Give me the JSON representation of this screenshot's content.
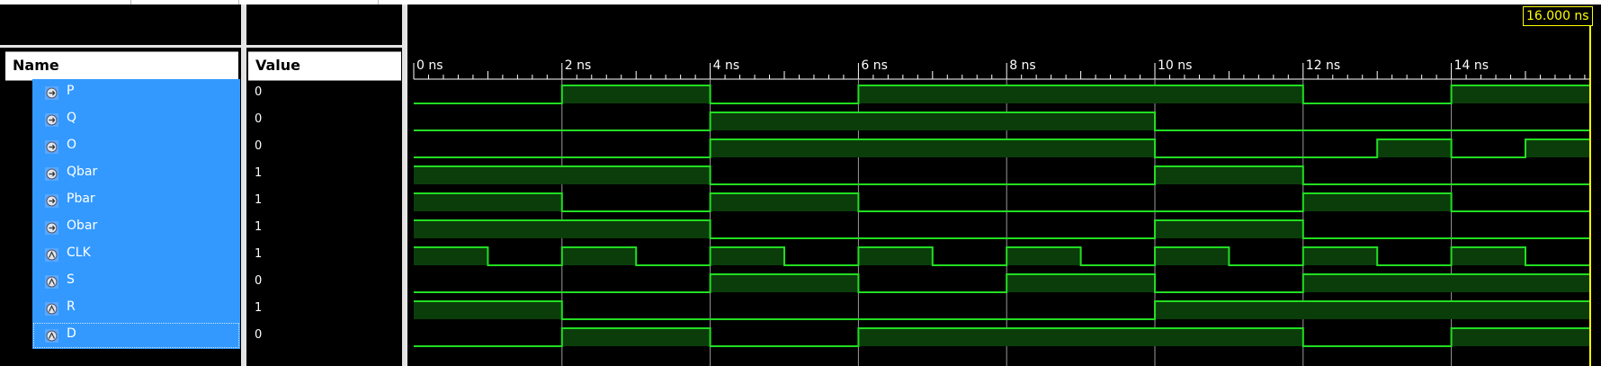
{
  "headers": {
    "name": "Name",
    "value": "Value"
  },
  "cursor": {
    "label": "16.000 ns"
  },
  "timeline": {
    "ticks": [
      "0 ns",
      "2 ns",
      "4 ns",
      "6 ns",
      "8 ns",
      "10 ns",
      "12 ns",
      "14 ns"
    ]
  },
  "signals": [
    {
      "name": "P",
      "value": "0",
      "icon": "output-signal-icon",
      "wave": [
        0,
        1,
        0,
        1,
        1,
        1,
        0,
        1
      ]
    },
    {
      "name": "Q",
      "value": "0",
      "icon": "output-signal-icon",
      "wave": [
        0,
        0,
        1,
        1,
        1,
        0,
        0,
        0
      ]
    },
    {
      "name": "O",
      "value": "0",
      "icon": "output-signal-icon",
      "wave": [
        0,
        0,
        1,
        1,
        1,
        0,
        0,
        0
      ],
      "extra": [
        [
          13,
          14,
          1
        ],
        [
          15,
          16,
          1
        ]
      ]
    },
    {
      "name": "Qbar",
      "value": "1",
      "icon": "output-signal-icon",
      "wave": [
        1,
        1,
        0,
        0,
        0,
        1,
        0,
        0
      ]
    },
    {
      "name": "Pbar",
      "value": "1",
      "icon": "output-signal-icon",
      "wave": [
        1,
        0,
        1,
        0,
        0,
        0,
        1,
        0
      ]
    },
    {
      "name": "Obar",
      "value": "1",
      "icon": "output-signal-icon",
      "wave": [
        1,
        1,
        0,
        0,
        0,
        1,
        0,
        0
      ]
    },
    {
      "name": "CLK",
      "value": "1",
      "icon": "input-signal-icon",
      "clock": true
    },
    {
      "name": "S",
      "value": "0",
      "icon": "input-signal-icon",
      "wave": [
        0,
        0,
        1,
        0,
        1,
        0,
        1,
        1
      ]
    },
    {
      "name": "R",
      "value": "1",
      "icon": "input-signal-icon",
      "wave": [
        1,
        0,
        0,
        0,
        0,
        1,
        1,
        1
      ]
    },
    {
      "name": "D",
      "value": "0",
      "icon": "input-signal-icon",
      "wave": [
        0,
        1,
        0,
        1,
        1,
        1,
        0,
        1
      ]
    }
  ],
  "colors": {
    "wave": "#22dd22",
    "fill": "#0a3d0a",
    "cursor": "#ffff00",
    "select": "#3399ff"
  }
}
